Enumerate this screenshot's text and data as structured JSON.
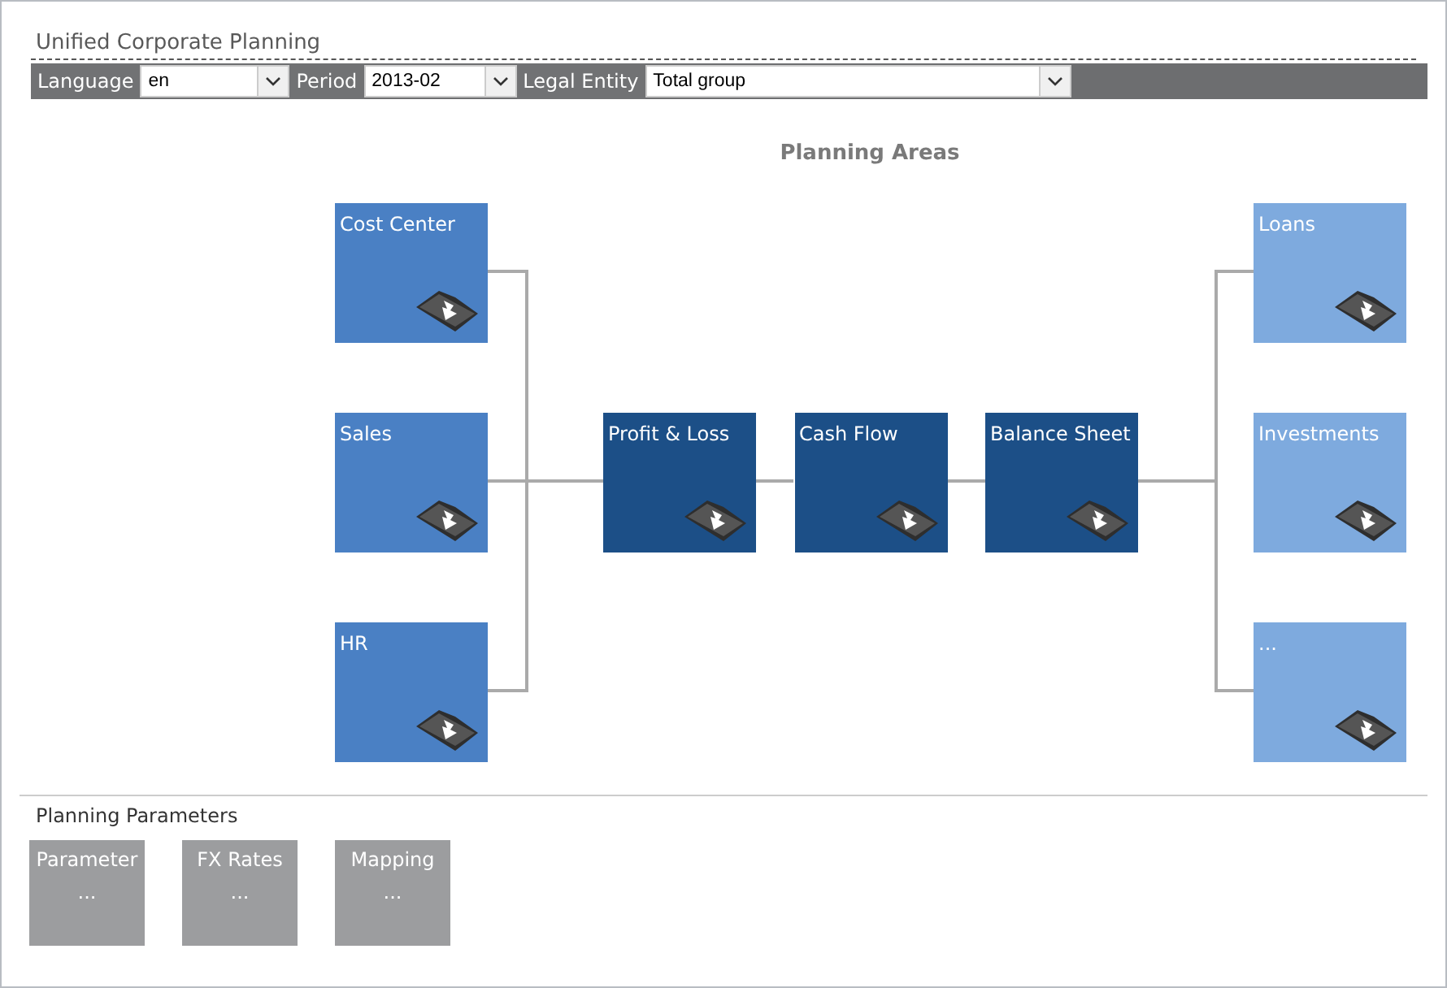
{
  "window": {
    "title": "Unified Corporate Planning"
  },
  "filters": [
    {
      "label": "Language",
      "value": "en"
    },
    {
      "label": "Period",
      "value": "2013-02"
    },
    {
      "label": "Legal Entity",
      "value": "Total group"
    }
  ],
  "planning_areas": {
    "title": "Planning Areas",
    "tiles": [
      {
        "label": "Cost Center",
        "kind": "input"
      },
      {
        "label": "Sales",
        "kind": "input"
      },
      {
        "label": "HR",
        "kind": "input"
      },
      {
        "label": "Profit & Loss",
        "kind": "report"
      },
      {
        "label": "Cash Flow",
        "kind": "report"
      },
      {
        "label": "Balance Sheet",
        "kind": "report"
      },
      {
        "label": "Loans",
        "kind": "detail"
      },
      {
        "label": "Investments",
        "kind": "detail"
      },
      {
        "label": "...",
        "kind": "detail"
      }
    ]
  },
  "planning_parameters": {
    "title": "Planning Parameters",
    "tiles": [
      {
        "label": "Parameter",
        "value": "..."
      },
      {
        "label": "FX Rates",
        "value": "..."
      },
      {
        "label": "Mapping",
        "value": "..."
      }
    ]
  }
}
